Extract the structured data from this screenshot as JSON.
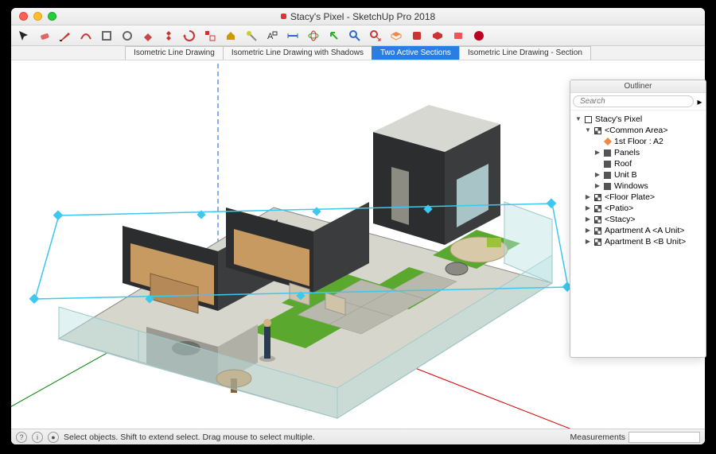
{
  "window": {
    "title": "Stacy's Pixel - SketchUp Pro 2018"
  },
  "toolbar_icons": [
    "select-arrow-icon",
    "eraser-icon",
    "pencil-icon",
    "arc-icon",
    "rectangle-icon",
    "circle-icon",
    "pushpull-icon",
    "move-icon",
    "rotate-icon",
    "scale-icon",
    "paint-bucket-icon",
    "tape-icon",
    "text-icon",
    "dimension-icon",
    "orbit-icon",
    "pan-icon",
    "zoom-icon",
    "zoom-extents-icon",
    "section-icon",
    "layer-icon",
    "warehouse-icon",
    "extension-icon",
    "ruby-icon"
  ],
  "scene_tabs": [
    {
      "label": "Isometric Line Drawing",
      "active": false
    },
    {
      "label": "Isometric Line Drawing with Shadows",
      "active": false
    },
    {
      "label": "Two Active Sections",
      "active": true
    },
    {
      "label": "Isometric Line Drawing - Section",
      "active": false
    }
  ],
  "outliner": {
    "title": "Outliner",
    "search_placeholder": "Search",
    "tree": [
      {
        "depth": 0,
        "disclosure": "▼",
        "icon": "model",
        "label": "Stacy's Pixel"
      },
      {
        "depth": 1,
        "disclosure": "▼",
        "icon": "comp4",
        "label": "<Common Area>"
      },
      {
        "depth": 2,
        "disclosure": "",
        "icon": "section",
        "label": "1st Floor : A2"
      },
      {
        "depth": 2,
        "disclosure": "▶",
        "icon": "filled",
        "label": "Panels"
      },
      {
        "depth": 2,
        "disclosure": "",
        "icon": "filled",
        "label": "Roof"
      },
      {
        "depth": 2,
        "disclosure": "▶",
        "icon": "filled",
        "label": "Unit B"
      },
      {
        "depth": 2,
        "disclosure": "▶",
        "icon": "filled",
        "label": "Windows"
      },
      {
        "depth": 1,
        "disclosure": "▶",
        "icon": "comp4",
        "label": "<Floor Plate>"
      },
      {
        "depth": 1,
        "disclosure": "▶",
        "icon": "comp4",
        "label": "<Patio>"
      },
      {
        "depth": 1,
        "disclosure": "▶",
        "icon": "comp4",
        "label": "<Stacy>"
      },
      {
        "depth": 1,
        "disclosure": "▶",
        "icon": "comp4",
        "label": "Apartment A <A Unit>"
      },
      {
        "depth": 1,
        "disclosure": "▶",
        "icon": "comp4",
        "label": "Apartment B <B Unit>"
      }
    ]
  },
  "statusbar": {
    "hint": "Select objects. Shift to extend select. Drag mouse to select multiple.",
    "measurements_label": "Measurements"
  },
  "colors": {
    "axis_red": "#d40000",
    "axis_green": "#008000",
    "axis_blue": "#1060d8",
    "section_cyan": "#3cc8ef",
    "grass": "#5aa82e",
    "wood": "#b68a58",
    "siding_dark": "#2b2d2f",
    "glass": "#bde2e2",
    "concrete": "#b8b8ac"
  }
}
